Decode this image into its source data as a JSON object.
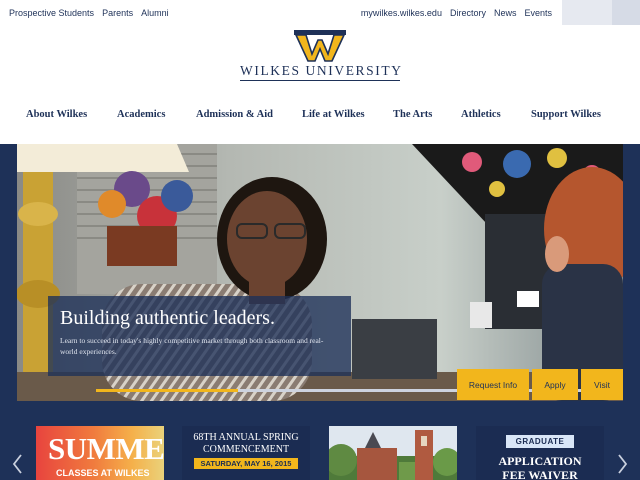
{
  "utility_nav": {
    "left_links": [
      "Prospective Students",
      "Parents",
      "Alumni"
    ],
    "right_links": [
      "mywilkes.wilkes.edu",
      "Directory",
      "News",
      "Events"
    ]
  },
  "logo": {
    "wordmark": "WILKES UNIVERSITY"
  },
  "main_nav": [
    "About Wilkes",
    "Academics",
    "Admission & Aid",
    "Life at Wilkes",
    "The Arts",
    "Athletics",
    "Support Wilkes"
  ],
  "hero": {
    "title": "Building authentic leaders.",
    "text": "Learn to succeed in today's highly competitive market through both classroom and real-world experiences.",
    "progress_fraction": 0.28
  },
  "cta_buttons": [
    "Request Info",
    "Apply",
    "Visit"
  ],
  "carousel": {
    "summer": {
      "big": "SUMMER",
      "small": "CLASSES AT WILKES"
    },
    "commencement": {
      "line1": "68TH ANNUAL SPRING",
      "line2": "COMMENCEMENT",
      "date": "SATURDAY, MAY 16, 2015"
    },
    "graduate": {
      "tag": "GRADUATE",
      "line1": "APPLICATION",
      "line2": "FEE WAIVER"
    }
  },
  "colors": {
    "navy": "#1e3158",
    "gold": "#f2b61c"
  }
}
